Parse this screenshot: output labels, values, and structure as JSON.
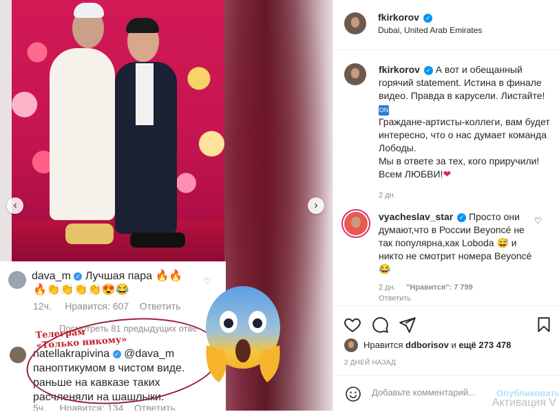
{
  "media": {
    "embedded_comments": {
      "c1_user": "dava_m",
      "c1_text": "Лучшая пара 🔥🔥",
      "c1_text2": "🔥👏👏👏👏😍😂",
      "c1_time": "12ч.",
      "c1_likes": "Нравится: 607",
      "c1_reply": "Ответить",
      "view_more": "Посмотреть 81 предыдущих отве",
      "c2_user": "natellakrapivina",
      "c2_line1": "@dava_m",
      "c2_line2": "паноптикумом в чистом виде.",
      "c2_line3": "раньше на кавказе таких",
      "c2_line4": "расчленяли на шашлыки.",
      "c2_time": "5ч.",
      "c2_likes": "Нравится: 134",
      "c2_reply": "Ответить"
    },
    "stamp_line1": "Телеграм",
    "stamp_line2": "«Только никому»",
    "watermark": "Активация V",
    "prev": "‹",
    "next": "›"
  },
  "post": {
    "author": "fkirkorov",
    "location": "Dubai, United Arab Emirates",
    "caption_author": "fkirkorov",
    "caption_lines": [
      "А вот и обещанный горячий statement. Истина в финале видео. Правда в карусели. Листайте!",
      "Граждане-артисты-коллеги, вам будет интересно, что о нас думает команда Лободы.",
      "Мы в ответе за тех, кого приручили! Всем ЛЮБВИ!"
    ],
    "tv_icon": "ON",
    "caption_time": "2 дн.",
    "comment": {
      "user": "vyacheslav_star",
      "text": "Просто они думают,что в России Beyoncé не так популярна,как Loboda 😅 и никто не смотрит номера Beyoncé😂",
      "time": "2 дн.",
      "likes": "\"Нравится\": 7 799",
      "reply": "Ответить"
    },
    "likes_prefix": "Нравится",
    "likes_user": "ddborisov",
    "likes_and": "и",
    "likes_count": "ещё 273 478",
    "date": "2 ДНЕЙ НАЗАД",
    "add_comment_placeholder": "Добавьте комментарий...",
    "publish": "Опубликовать"
  },
  "colors": {
    "accent": "#0095f6",
    "like_red": "#e0245e",
    "muted": "#8e8e8e"
  }
}
